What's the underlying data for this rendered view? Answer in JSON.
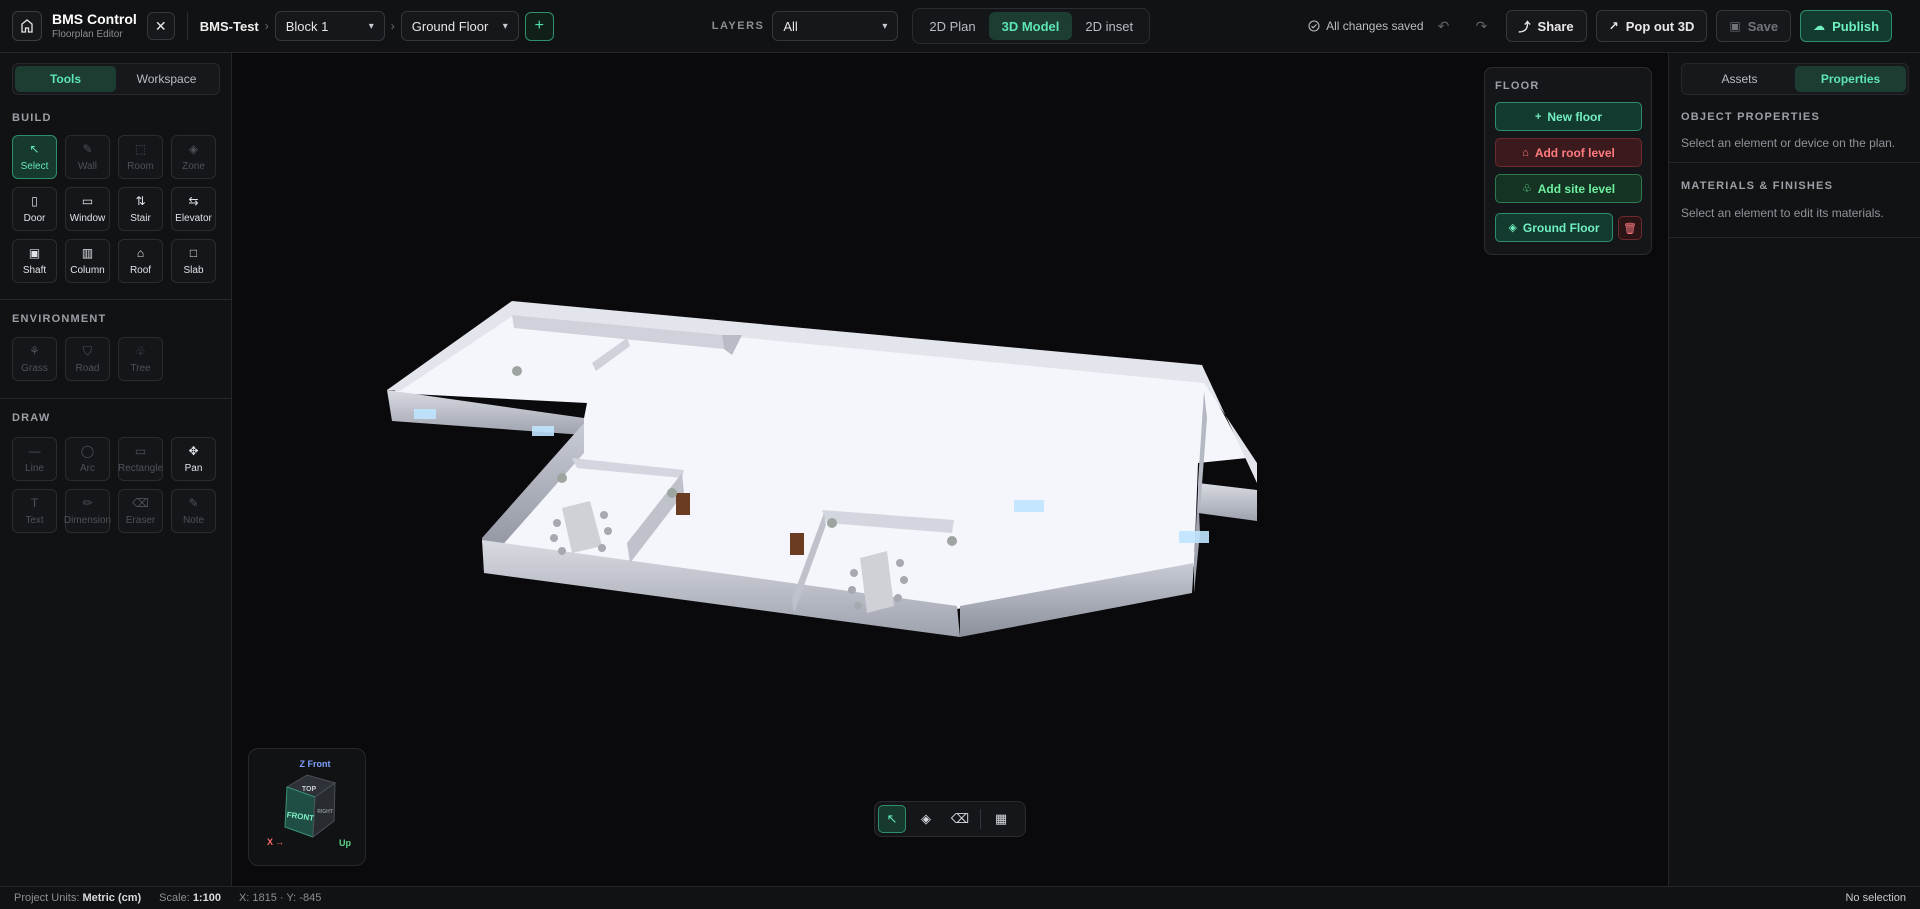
{
  "app": {
    "title": "BMS Control",
    "subtitle": "Floorplan Editor",
    "close_icon": "close-icon"
  },
  "breadcrumb": {
    "project": "BMS-Test",
    "block": "Block 1",
    "floor": "Ground Floor"
  },
  "layers": {
    "label": "LAYERS",
    "value": "All"
  },
  "view_tabs": [
    {
      "label": "2D Plan",
      "active": false
    },
    {
      "label": "3D Model",
      "active": true
    },
    {
      "label": "2D inset",
      "active": false
    }
  ],
  "status_saved": "All changes saved",
  "actions": {
    "share": "Share",
    "popout": "Pop out 3D",
    "save": "Save",
    "publish": "Publish"
  },
  "left_tabs": [
    "Tools",
    "Workspace"
  ],
  "sections": {
    "build": {
      "title": "BUILD",
      "tools": [
        {
          "label": "Select",
          "icon": "↖",
          "state": "active"
        },
        {
          "label": "Wall",
          "icon": "✎",
          "state": "disabled"
        },
        {
          "label": "Room",
          "icon": "⬚",
          "state": "disabled"
        },
        {
          "label": "Zone",
          "icon": "◈",
          "state": "disabled"
        },
        {
          "label": "Door",
          "icon": "▯",
          "state": "normal"
        },
        {
          "label": "Window",
          "icon": "▭",
          "state": "normal"
        },
        {
          "label": "Stair",
          "icon": "⇅",
          "state": "normal"
        },
        {
          "label": "Elevator",
          "icon": "⇆",
          "state": "normal"
        },
        {
          "label": "Shaft",
          "icon": "▣",
          "state": "normal"
        },
        {
          "label": "Column",
          "icon": "▥",
          "state": "normal"
        },
        {
          "label": "Roof",
          "icon": "⌂",
          "state": "normal"
        },
        {
          "label": "Slab",
          "icon": "□",
          "state": "normal"
        }
      ]
    },
    "environment": {
      "title": "ENVIRONMENT",
      "tools": [
        {
          "label": "Grass",
          "icon": "⚘",
          "state": "disabled"
        },
        {
          "label": "Road",
          "icon": "⛉",
          "state": "disabled"
        },
        {
          "label": "Tree",
          "icon": "♧",
          "state": "disabled"
        }
      ]
    },
    "draw": {
      "title": "DRAW",
      "tools": [
        {
          "label": "Line",
          "icon": "—",
          "state": "disabled"
        },
        {
          "label": "Arc",
          "icon": "◯",
          "state": "disabled"
        },
        {
          "label": "Rectangle",
          "icon": "▭",
          "state": "disabled"
        },
        {
          "label": "Pan",
          "icon": "✥",
          "state": "normal"
        },
        {
          "label": "Text",
          "icon": "T",
          "state": "disabled"
        },
        {
          "label": "Dimension",
          "icon": "✏",
          "state": "disabled"
        },
        {
          "label": "Eraser",
          "icon": "⌫",
          "state": "disabled"
        },
        {
          "label": "Note",
          "icon": "✎",
          "state": "disabled"
        }
      ]
    }
  },
  "floor_panel": {
    "title": "FLOOR",
    "new_floor": "New floor",
    "add_roof": "Add roof level",
    "add_site": "Add site level",
    "current": "Ground Floor"
  },
  "navcube": {
    "z": "Z Front",
    "x": "X",
    "up": "Up",
    "top": "TOP",
    "front": "FRONT",
    "right": "RIGHT"
  },
  "right_tabs": [
    "Assets",
    "Properties"
  ],
  "properties": {
    "obj_title": "OBJECT PROPERTIES",
    "obj_text": "Select an element or device on the plan.",
    "mat_title": "MATERIALS & FINISHES",
    "mat_text": "Select an element to edit its materials."
  },
  "statusbar": {
    "units_label": "Project Units:",
    "units_value": "Metric (cm)",
    "scale_label": "Scale:",
    "scale_value": "1:100",
    "coords": "X: 1815 · Y: -845",
    "selection": "No selection"
  },
  "colors": {
    "accent": "#5ee5b4",
    "danger": "#ff7b80",
    "site": "#6ff0a0"
  }
}
